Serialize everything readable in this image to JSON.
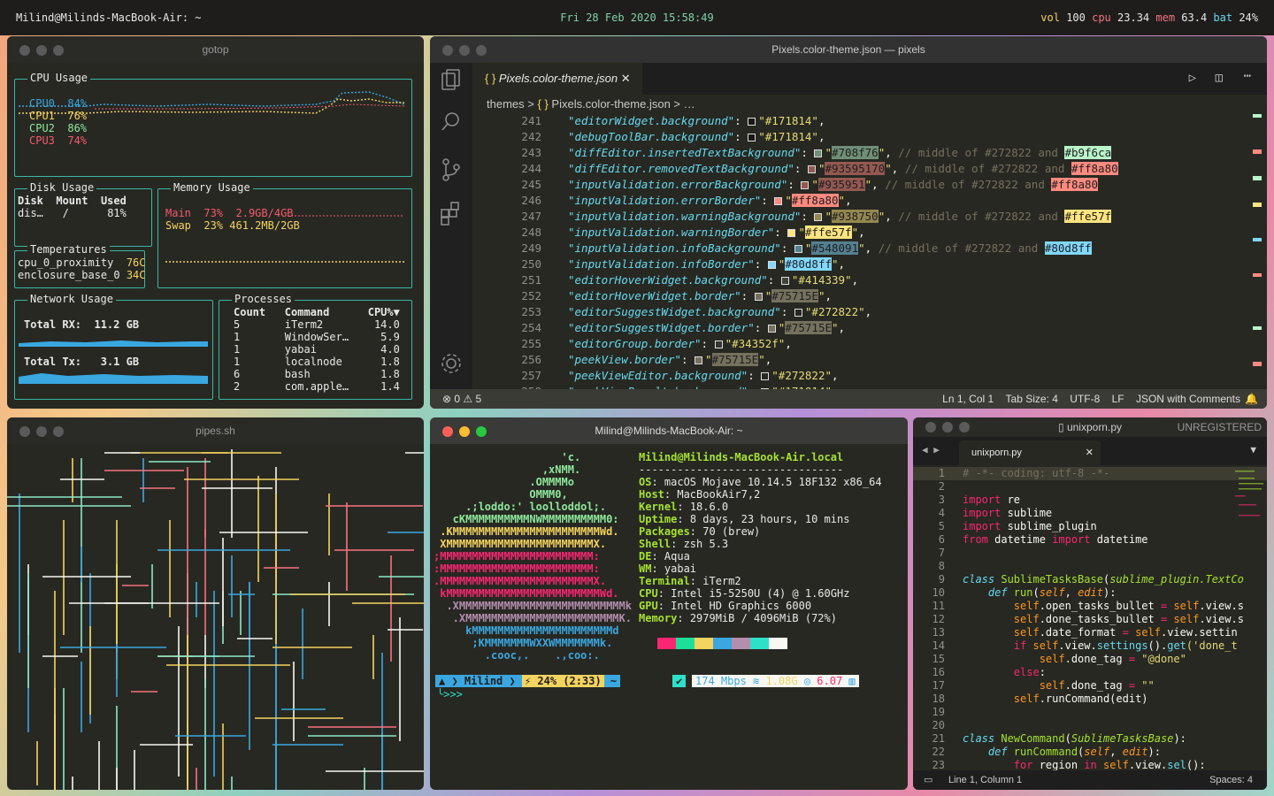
{
  "topbar": {
    "left": "Milind@Milinds-MacBook-Air: ~",
    "center": "Fri 28 Feb 2020 15:58:49",
    "stats": [
      {
        "k": "vol",
        "v": "100",
        "kc": "#f4d35e"
      },
      {
        "k": "cpu",
        "v": "23.34",
        "kc": "#f67280"
      },
      {
        "k": "mem",
        "v": "63.4",
        "kc": "#f67280"
      },
      {
        "k": "bat",
        "v": "24%",
        "kc": "#66d9ef"
      }
    ]
  },
  "gotop": {
    "title": "gotop",
    "cpu": {
      "title": "CPU Usage",
      "rows": [
        {
          "label": "CPU0",
          "val": "84%",
          "color": "#3aa7e0"
        },
        {
          "label": "CPU1",
          "val": "76%",
          "color": "#f4d35e"
        },
        {
          "label": "CPU2",
          "val": "86%",
          "color": "#8ee89c"
        },
        {
          "label": "CPU3",
          "val": "74%",
          "color": "#f55a6d"
        }
      ]
    },
    "disk": {
      "title": "Disk Usage",
      "headers": [
        "Disk",
        "Mount",
        "Used"
      ],
      "row": [
        "dis…",
        "/",
        "81%"
      ]
    },
    "mem": {
      "title": "Memory Usage",
      "main": {
        "label": "Main",
        "pct": "73%",
        "val": "2.9GB/4GB"
      },
      "swap": {
        "label": "Swap",
        "pct": "23%",
        "val": "461.2MB/2GB"
      }
    },
    "temp": {
      "title": "Temperatures",
      "rows": [
        {
          "n": "cpu_0_proximity",
          "v": "76C"
        },
        {
          "n": "enclosure_base_0",
          "v": "34C"
        }
      ]
    },
    "net": {
      "title": "Network Usage",
      "rx": "Total RX:  11.2 GB",
      "tx": "Total Tx:   3.1 GB"
    },
    "proc": {
      "title": "Processes",
      "headers": [
        "Count",
        "Command",
        "CPU%▼"
      ],
      "rows": [
        [
          "5",
          "iTerm2",
          "14.0"
        ],
        [
          "1",
          "WindowSer…",
          "5.9"
        ],
        [
          "1",
          "yabai",
          "4.0"
        ],
        [
          "1",
          "localnode",
          "1.8"
        ],
        [
          "6",
          "bash",
          "1.8"
        ],
        [
          "2",
          "com.apple…",
          "1.4"
        ]
      ]
    }
  },
  "vscode": {
    "title": "Pixels.color-theme.json — pixels",
    "tab": "Pixels.color-theme.json",
    "crumb": [
      "themes",
      ">",
      "{ }",
      "Pixels.color-theme.json",
      ">",
      "…"
    ],
    "lines": [
      {
        "n": "241",
        "key": "\"editorWidget.background\"",
        "val": "\"#171814\"",
        "sw": "#171814",
        "tail": ","
      },
      {
        "n": "242",
        "key": "\"debugToolBar.background\"",
        "val": "\"#171814\"",
        "sw": "#171814",
        "tail": ","
      },
      {
        "n": "243",
        "key": "\"diffEditor.insertedTextBackground\"",
        "val": "#708f76",
        "hl": "#708f76",
        "sw": "#708f76",
        "cmt": "// middle of #272822 and",
        "c2": "#b9f6ca",
        "c2hl": "#b9f6ca"
      },
      {
        "n": "244",
        "key": "\"diffEditor.removedTextBackground\"",
        "val": "#93595170",
        "hl": "#935951",
        "sw": "#935951",
        "cmt": "// middle of #272822 and",
        "c2": "#ff8a80",
        "c2hl": "#ff8a80"
      },
      {
        "n": "245",
        "key": "\"inputValidation.errorBackground\"",
        "val": "#935951",
        "hl": "#935951",
        "sw": "#935951",
        "cmt": "// middle of #272822 and",
        "c2": "#ff8a80",
        "c2hl": "#ff8a80"
      },
      {
        "n": "246",
        "key": "\"inputValidation.errorBorder\"",
        "val": "#ff8a80",
        "hl": "#ff8a80",
        "sw": "#ff8a80",
        "tail": ","
      },
      {
        "n": "247",
        "key": "\"inputValidation.warningBackground\"",
        "val": "#938750",
        "hl": "#938750",
        "sw": "#938750",
        "cmt": "// middle of #272822 and",
        "c2": "#ffe57f",
        "c2hl": "#ffe57f"
      },
      {
        "n": "248",
        "key": "\"inputValidation.warningBorder\"",
        "val": "#ffe57f",
        "hl": "#ffe57f",
        "sw": "#ffe57f",
        "tail": ","
      },
      {
        "n": "249",
        "key": "\"inputValidation.infoBackground\"",
        "val": "#548091",
        "hl": "#548091",
        "sw": "#548091",
        "cmt": "// middle of #272822 and",
        "c2": "#80d8ff",
        "c2hl": "#80d8ff"
      },
      {
        "n": "250",
        "key": "\"inputValidation.infoBorder\"",
        "val": "#80d8ff",
        "hl": "#80d8ff",
        "sw": "#80d8ff",
        "tail": ","
      },
      {
        "n": "251",
        "key": "\"editorHoverWidget.background\"",
        "val": "\"#414339\"",
        "sw": "#414339",
        "tail": ","
      },
      {
        "n": "252",
        "key": "\"editorHoverWidget.border\"",
        "val": "#75715E",
        "hl": "#75715e",
        "sw": "#75715e",
        "tail": ","
      },
      {
        "n": "253",
        "key": "\"editorSuggestWidget.background\"",
        "val": "\"#272822\"",
        "sw": "#272822",
        "tail": ","
      },
      {
        "n": "254",
        "key": "\"editorSuggestWidget.border\"",
        "val": "#75715E",
        "hl": "#75715e",
        "sw": "#75715e",
        "tail": ","
      },
      {
        "n": "255",
        "key": "\"editorGroup.border\"",
        "val": "\"#34352f\"",
        "sw": "#34352f",
        "tail": ","
      },
      {
        "n": "256",
        "key": "\"peekView.border\"",
        "val": "#75715E",
        "hl": "#75715e",
        "sw": "#75715e",
        "tail": ","
      },
      {
        "n": "257",
        "key": "\"peekViewEditor.background\"",
        "val": "\"#272822\"",
        "sw": "#272822",
        "tail": ","
      },
      {
        "n": "258",
        "key": "\"peekViewResult.background\"",
        "val": "\"#171814\"",
        "sw": "#171814",
        "tail": ","
      }
    ],
    "status": {
      "errors": "0",
      "warnings": "5",
      "pos": "Ln 1, Col 1",
      "tab": "Tab Size: 4",
      "enc": "UTF-8",
      "eol": "LF",
      "lang": "JSON with Comments"
    }
  },
  "pipes": {
    "title": "pipes.sh"
  },
  "neofetch": {
    "title": "Milind@Milinds-MacBook-Air: ~",
    "logo": [
      "                    'c.",
      "                 ,xNMM.",
      "               .OMMMMo",
      "               OMMM0,",
      "     .;loddo:' loolloddol;.",
      "   cKMMMMMMMMMMNWMMMMMMMMMM0:",
      " .KMMMMMMMMMMMMMMMMMMMMMMMWd.",
      " XMMMMMMMMMMMMMMMMMMMMMMMX.",
      ";MMMMMMMMMMMMMMMMMMMMMMMM:",
      ":MMMMMMMMMMMMMMMMMMMMMMMM:",
      ".MMMMMMMMMMMMMMMMMMMMMMMMX.",
      " kMMMMMMMMMMMMMMMMMMMMMMMMWd.",
      "  .XMMMMMMMMMMMMMMMMMMMMMMMMMMk",
      "   .XMMMMMMMMMMMMMMMMMMMMMMMMK.",
      "     kMMMMMMMMMMMMMMMMMMMMMMd",
      "      ;KMMMMMMMWXXWMMMMMMMk.",
      "        .cooc,.    .,coo:."
    ],
    "host": "Milind@Milinds-MacBook-Air.local",
    "sep": "--------------------------------",
    "info": [
      [
        "OS",
        "macOS Mojave 10.14.5 18F132 x86_64"
      ],
      [
        "Host",
        "MacBookAir7,2"
      ],
      [
        "Kernel",
        "18.6.0"
      ],
      [
        "Uptime",
        "8 days, 23 hours, 10 mins"
      ],
      [
        "Packages",
        "70 (brew)"
      ],
      [
        "Shell",
        "zsh 5.3"
      ],
      [
        "DE",
        "Aqua"
      ],
      [
        "WM",
        "yabai"
      ],
      [
        "Terminal",
        "iTerm2"
      ],
      [
        "CPU",
        "Intel i5-5250U (4) @ 1.60GHz"
      ],
      [
        "GPU",
        "Intel HD Graphics 6000"
      ],
      [
        "Memory",
        "2979MiB / 4096MiB (72%)"
      ]
    ],
    "palette": [
      "#272822",
      "#f92672",
      "#1ddf9a",
      "#f4d35e",
      "#3aa7e0",
      "#b48ead",
      "#2fe0c8",
      "#f8f8f2"
    ],
    "prompt": {
      "user": "Milind",
      "bat": "⚡ 24% (2:33)",
      "dir": "~",
      "net": "174 Mbps",
      "mem": "1.08G",
      "cpu": "6.07",
      "cursor": "╰>>>"
    }
  },
  "sublime": {
    "title": "unixporn.py",
    "unreg": "UNREGISTERED",
    "tab": "unixporn.py",
    "lines": [
      [
        [
          "# -*- coding: utf-8 -*-",
          "#75715e"
        ]
      ],
      [],
      [
        [
          "import ",
          "#f92672"
        ],
        [
          "re",
          "#f8f8f2"
        ]
      ],
      [
        [
          "import ",
          "#f92672"
        ],
        [
          "sublime",
          "#f8f8f2"
        ]
      ],
      [
        [
          "import ",
          "#f92672"
        ],
        [
          "sublime_plugin",
          "#f8f8f2"
        ]
      ],
      [
        [
          "from ",
          "#f92672"
        ],
        [
          "datetime ",
          "#f8f8f2"
        ],
        [
          "import ",
          "#f92672"
        ],
        [
          "datetime",
          "#f8f8f2"
        ]
      ],
      [],
      [],
      [
        [
          "class ",
          "#66d9ef",
          "i"
        ],
        [
          "SublimeTasksBase",
          "#a6e22e"
        ],
        [
          "(",
          "#f8f8f2"
        ],
        [
          "sublime_plugin.TextCo",
          "#a6e22e",
          "i"
        ]
      ],
      [
        [
          "    def ",
          "#66d9ef",
          "i"
        ],
        [
          "run",
          "#a6e22e"
        ],
        [
          "(",
          "#f8f8f2"
        ],
        [
          "self",
          "#fd971f",
          "i"
        ],
        [
          ", ",
          "#f8f8f2"
        ],
        [
          "edit",
          "#fd971f",
          "i"
        ],
        [
          "):",
          "#f8f8f2"
        ]
      ],
      [
        [
          "        self",
          "#fd971f"
        ],
        [
          ".open_tasks_bullet ",
          "#f8f8f2"
        ],
        [
          "= ",
          "#f92672"
        ],
        [
          "self",
          "#fd971f"
        ],
        [
          ".view.s",
          "#f8f8f2"
        ]
      ],
      [
        [
          "        self",
          "#fd971f"
        ],
        [
          ".done_tasks_bullet ",
          "#f8f8f2"
        ],
        [
          "= ",
          "#f92672"
        ],
        [
          "self",
          "#fd971f"
        ],
        [
          ".view.s",
          "#f8f8f2"
        ]
      ],
      [
        [
          "        self",
          "#fd971f"
        ],
        [
          ".date_format ",
          "#f8f8f2"
        ],
        [
          "= ",
          "#f92672"
        ],
        [
          "self",
          "#fd971f"
        ],
        [
          ".view.settin",
          "#f8f8f2"
        ]
      ],
      [
        [
          "        if ",
          "#f92672"
        ],
        [
          "self",
          "#fd971f"
        ],
        [
          ".view.",
          "#f8f8f2"
        ],
        [
          "settings",
          "#66d9ef"
        ],
        [
          "().",
          "#f8f8f2"
        ],
        [
          "get",
          "#66d9ef"
        ],
        [
          "('done_t",
          "#e6db74"
        ]
      ],
      [
        [
          "            self",
          "#fd971f"
        ],
        [
          ".done_tag ",
          "#f8f8f2"
        ],
        [
          "= ",
          "#f92672"
        ],
        [
          "\"@done\"",
          "#e6db74"
        ]
      ],
      [
        [
          "        else",
          "#f92672"
        ],
        [
          ":",
          "#f8f8f2"
        ]
      ],
      [
        [
          "            self",
          "#fd971f"
        ],
        [
          ".done_tag ",
          "#f8f8f2"
        ],
        [
          "= ",
          "#f92672"
        ],
        [
          "\"\"",
          "#e6db74"
        ]
      ],
      [
        [
          "        self",
          "#fd971f"
        ],
        [
          ".runCommand(edit)",
          "#f8f8f2"
        ]
      ],
      [],
      [],
      [
        [
          "class ",
          "#66d9ef",
          "i"
        ],
        [
          "NewCommand",
          "#a6e22e"
        ],
        [
          "(",
          "#f8f8f2"
        ],
        [
          "SublimeTasksBase",
          "#a6e22e",
          "i"
        ],
        [
          "):",
          "#f8f8f2"
        ]
      ],
      [
        [
          "    def ",
          "#66d9ef",
          "i"
        ],
        [
          "runCommand",
          "#a6e22e"
        ],
        [
          "(",
          "#f8f8f2"
        ],
        [
          "self",
          "#fd971f",
          "i"
        ],
        [
          ", ",
          "#f8f8f2"
        ],
        [
          "edit",
          "#fd971f",
          "i"
        ],
        [
          "):",
          "#f8f8f2"
        ]
      ],
      [
        [
          "        for ",
          "#f92672"
        ],
        [
          "region ",
          "#f8f8f2"
        ],
        [
          "in ",
          "#f92672"
        ],
        [
          "self",
          "#fd971f"
        ],
        [
          ".view.",
          "#f8f8f2"
        ],
        [
          "sel",
          "#66d9ef"
        ],
        [
          "():",
          "#f8f8f2"
        ]
      ]
    ],
    "status": {
      "pos": "Line 1, Column 1",
      "spaces": "Spaces: 4"
    }
  }
}
